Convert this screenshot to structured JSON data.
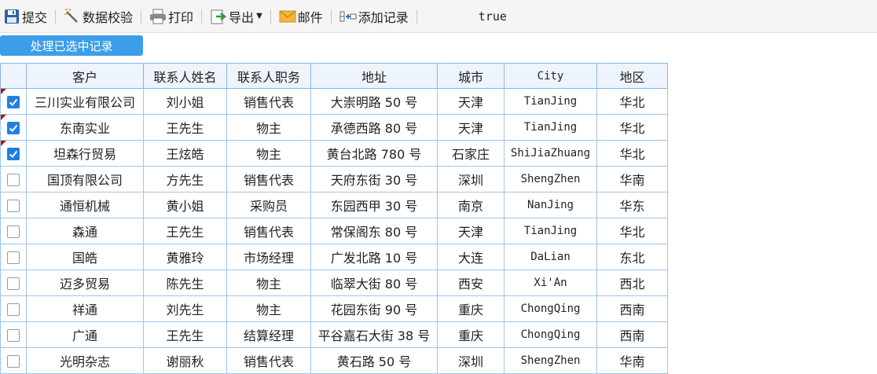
{
  "toolbar": {
    "submit_label": "提交",
    "validate_label": "数据校验",
    "print_label": "打印",
    "export_label": "导出",
    "mail_label": "邮件",
    "add_record_label": "添加记录",
    "status_text": "true"
  },
  "action_button_label": "处理已选中记录",
  "columns": [
    "客户",
    "联系人姓名",
    "联系人职务",
    "地址",
    "城市",
    "City",
    "地区"
  ],
  "rows": [
    {
      "checked": true,
      "customer": "三川实业有限公司",
      "contact": "刘小姐",
      "title": "销售代表",
      "address": "大崇明路 50 号",
      "city": "天津",
      "city_en": "TianJing",
      "region": "华北"
    },
    {
      "checked": true,
      "customer": "东南实业",
      "contact": "王先生",
      "title": "物主",
      "address": "承德西路 80 号",
      "city": "天津",
      "city_en": "TianJing",
      "region": "华北"
    },
    {
      "checked": true,
      "customer": "坦森行贸易",
      "contact": "王炫皓",
      "title": "物主",
      "address": "黄台北路 780 号",
      "city": "石家庄",
      "city_en": "ShiJiaZhuang",
      "region": "华北"
    },
    {
      "checked": false,
      "customer": "国顶有限公司",
      "contact": "方先生",
      "title": "销售代表",
      "address": "天府东街 30 号",
      "city": "深圳",
      "city_en": "ShengZhen",
      "region": "华南"
    },
    {
      "checked": false,
      "customer": "通恒机械",
      "contact": "黄小姐",
      "title": "采购员",
      "address": "东园西甲 30 号",
      "city": "南京",
      "city_en": "NanJing",
      "region": "华东"
    },
    {
      "checked": false,
      "customer": "森通",
      "contact": "王先生",
      "title": "销售代表",
      "address": "常保阁东 80 号",
      "city": "天津",
      "city_en": "TianJing",
      "region": "华北"
    },
    {
      "checked": false,
      "customer": "国皓",
      "contact": "黄雅玲",
      "title": "市场经理",
      "address": "广发北路 10 号",
      "city": "大连",
      "city_en": "DaLian",
      "region": "东北"
    },
    {
      "checked": false,
      "customer": "迈多贸易",
      "contact": "陈先生",
      "title": "物主",
      "address": "临翠大街 80 号",
      "city": "西安",
      "city_en": "Xi'An",
      "region": "西北"
    },
    {
      "checked": false,
      "customer": "祥通",
      "contact": "刘先生",
      "title": "物主",
      "address": "花园东街 90 号",
      "city": "重庆",
      "city_en": "ChongQing",
      "region": "西南"
    },
    {
      "checked": false,
      "customer": "广通",
      "contact": "王先生",
      "title": "结算经理",
      "address": "平谷嘉石大街 38 号",
      "city": "重庆",
      "city_en": "ChongQing",
      "region": "西南"
    },
    {
      "checked": false,
      "customer": "光明杂志",
      "contact": "谢丽秋",
      "title": "销售代表",
      "address": "黄石路 50 号",
      "city": "深圳",
      "city_en": "ShengZhen",
      "region": "华南"
    }
  ],
  "icons": {
    "submit": "save-icon",
    "validate": "magic-wand-icon",
    "print": "printer-icon",
    "export": "export-icon",
    "mail": "envelope-icon",
    "add_record": "add-record-icon"
  },
  "colors": {
    "accent": "#3d9ee8",
    "checkbox_checked": "#1e7fe0",
    "grid_border": "#9cc6ee",
    "dirty_marker": "#b0171e"
  }
}
